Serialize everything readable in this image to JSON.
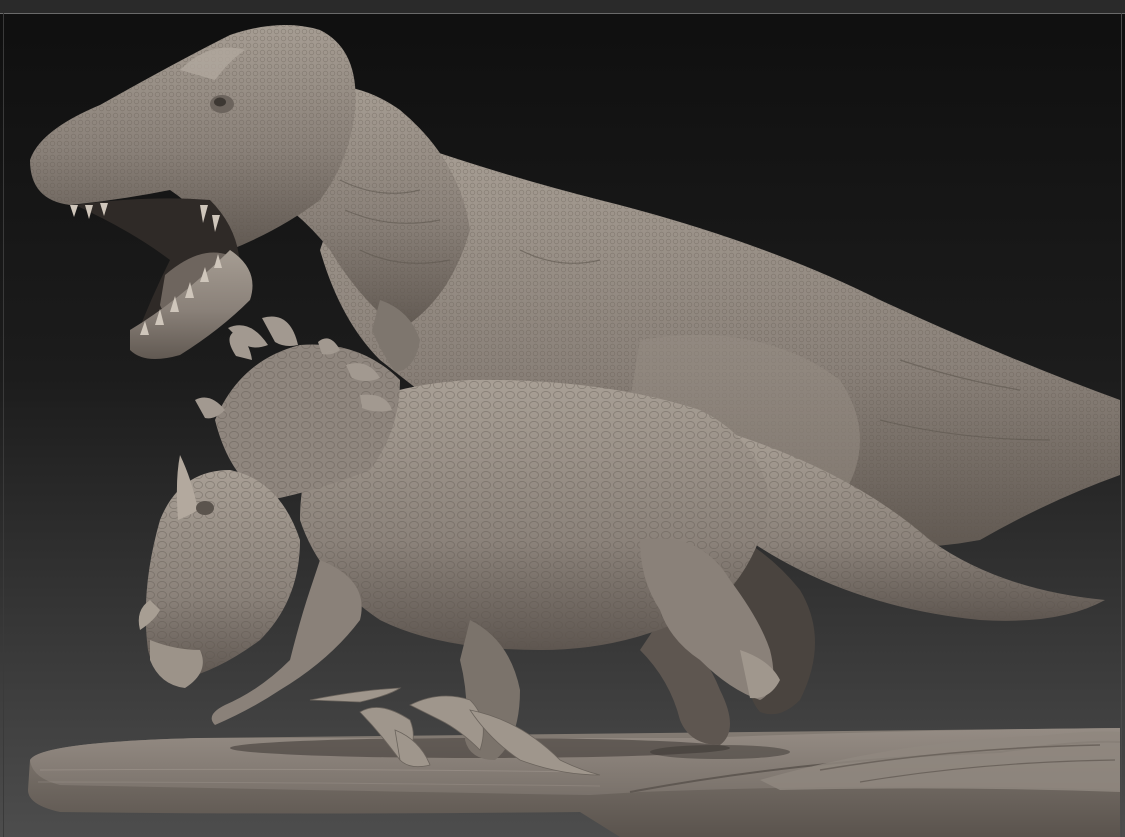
{
  "scene": {
    "subjects": [
      "tyrannosaurus-sculpt",
      "triceratops-sculpt",
      "base-platform",
      "splash-debris"
    ],
    "colors": {
      "background_top": "#0e0e0e",
      "background_bottom": "#474747",
      "clay": "#8d847c",
      "clay_light": "#aba298",
      "clay_dark": "#5c544d",
      "base": "#7b736c"
    }
  }
}
